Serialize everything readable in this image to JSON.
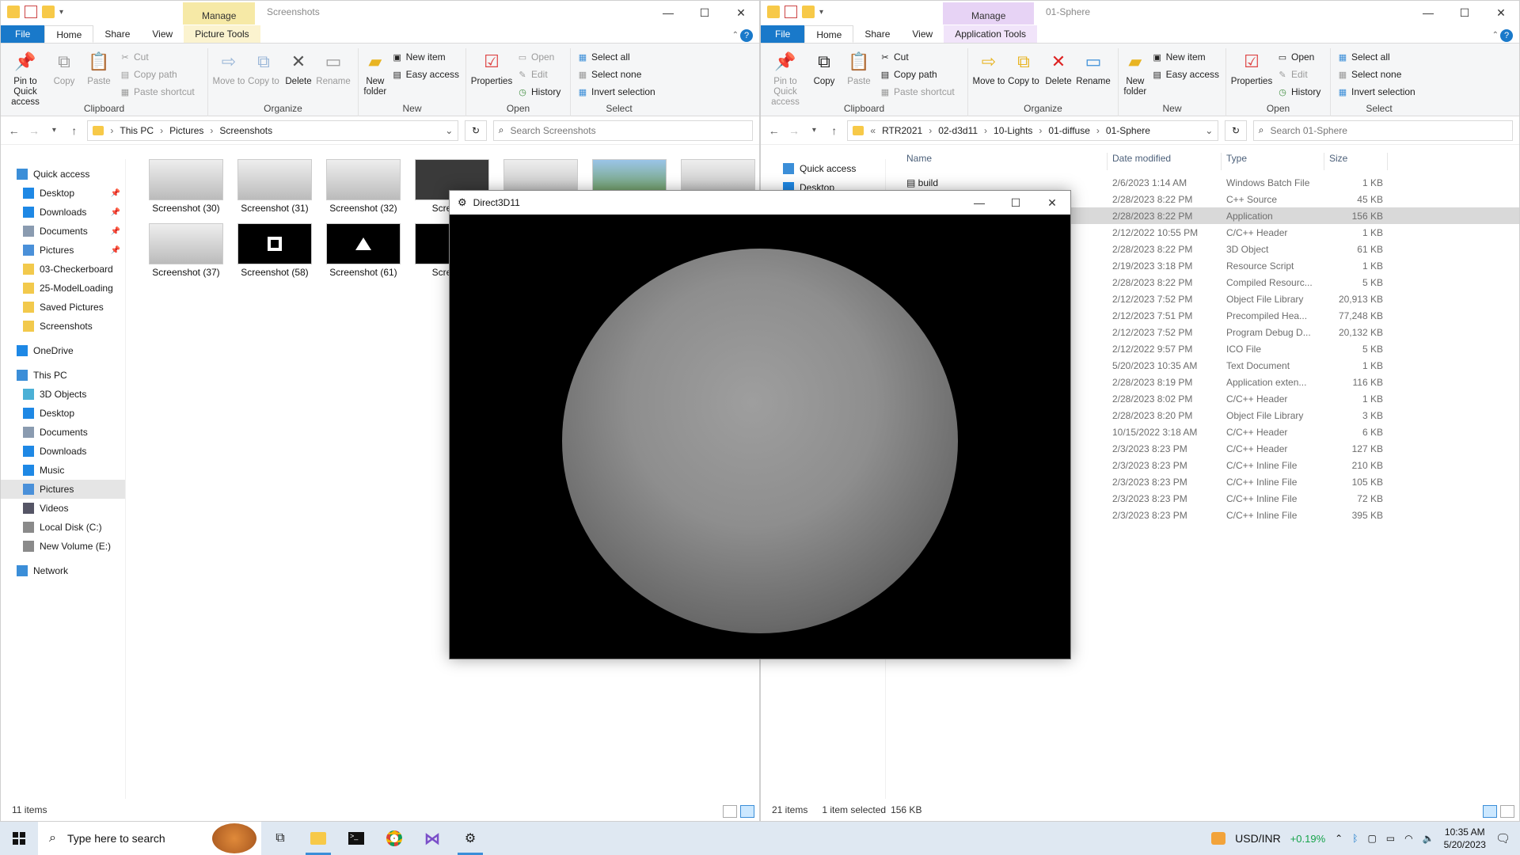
{
  "left": {
    "manage": "Manage",
    "title": "Screenshots",
    "tabs": [
      "File",
      "Home",
      "Share",
      "View",
      "Picture Tools"
    ],
    "ribbon": {
      "clipboard": {
        "label": "Clipboard",
        "pin": "Pin to Quick access",
        "copy": "Copy",
        "paste": "Paste",
        "cut": "Cut",
        "copy_path": "Copy path",
        "paste_shortcut": "Paste shortcut"
      },
      "organize": {
        "label": "Organize",
        "move": "Move to",
        "copy": "Copy to",
        "delete": "Delete",
        "rename": "Rename"
      },
      "new": {
        "label": "New",
        "folder": "New folder",
        "item": "New item",
        "easy": "Easy access"
      },
      "open": {
        "label": "Open",
        "properties": "Properties",
        "open": "Open",
        "edit": "Edit",
        "history": "History"
      },
      "select": {
        "label": "Select",
        "all": "Select all",
        "none": "Select none",
        "invert": "Invert selection"
      }
    },
    "crumbs": [
      "This PC",
      "Pictures",
      "Screenshots"
    ],
    "search_placeholder": "Search Screenshots",
    "nav": [
      {
        "label": "Quick access",
        "top": true,
        "icon": "star-icon"
      },
      {
        "label": "Desktop",
        "pin": true,
        "icon": "desktop-icon"
      },
      {
        "label": "Downloads",
        "pin": true,
        "icon": "download-icon"
      },
      {
        "label": "Documents",
        "pin": true,
        "icon": "documents-icon"
      },
      {
        "label": "Pictures",
        "pin": true,
        "icon": "pictures-icon"
      },
      {
        "label": "03-Checkerboard",
        "icon": "folder-icon"
      },
      {
        "label": "25-ModelLoading",
        "icon": "folder-icon"
      },
      {
        "label": "Saved Pictures",
        "icon": "folder-icon"
      },
      {
        "label": "Screenshots",
        "icon": "folder-icon"
      },
      {
        "label": "OneDrive",
        "top": true,
        "icon": "cloud-icon"
      },
      {
        "label": "This PC",
        "top": true,
        "icon": "pc-icon"
      },
      {
        "label": "3D Objects",
        "icon": "cube-icon"
      },
      {
        "label": "Desktop",
        "icon": "desktop-icon"
      },
      {
        "label": "Documents",
        "icon": "documents-icon"
      },
      {
        "label": "Downloads",
        "icon": "download-icon"
      },
      {
        "label": "Music",
        "icon": "music-icon"
      },
      {
        "label": "Pictures",
        "icon": "pictures-icon",
        "selected": true
      },
      {
        "label": "Videos",
        "icon": "video-icon"
      },
      {
        "label": "Local Disk (C:)",
        "icon": "disk-icon"
      },
      {
        "label": "New Volume (E:)",
        "icon": "disk-icon"
      },
      {
        "label": "Network",
        "top": true,
        "icon": "network-icon"
      }
    ],
    "thumbs": [
      {
        "label": "Screenshot (30)",
        "kind": "gray"
      },
      {
        "label": "Screenshot (31)",
        "kind": "gray"
      },
      {
        "label": "Screenshot (32)",
        "kind": "gray"
      },
      {
        "label": "Screensh",
        "kind": "dark"
      },
      {
        "label": "",
        "kind": "gray"
      },
      {
        "label": "",
        "kind": "tree"
      },
      {
        "label": "",
        "kind": "gray"
      },
      {
        "label": "Screenshot (37)",
        "kind": "gray"
      },
      {
        "label": "Screenshot (58)",
        "kind": "square"
      },
      {
        "label": "Screenshot (61)",
        "kind": "triangle"
      },
      {
        "label": "Screensh",
        "kind": "blk"
      }
    ],
    "status": {
      "items": "11 items"
    }
  },
  "right": {
    "manage": "Manage",
    "title": "01-Sphere",
    "tabs": [
      "File",
      "Home",
      "Share",
      "View",
      "Application Tools"
    ],
    "crumbs": [
      "RTR2021",
      "02-d3d11",
      "10-Lights",
      "01-diffuse",
      "01-Sphere"
    ],
    "crumb_prefix": "«",
    "search_placeholder": "Search 01-Sphere",
    "nav": [
      {
        "label": "Quick access",
        "icon": "star-icon"
      },
      {
        "label": "Desktop",
        "icon": "desktop-icon"
      }
    ],
    "headers": [
      "Name",
      "Date modified",
      "Type",
      "Size"
    ],
    "files": [
      {
        "name": "build",
        "date": "2/6/2023 1:14 AM",
        "type": "Windows Batch File",
        "size": "1 KB"
      },
      {
        "name": "",
        "date": "2/28/2023 8:22 PM",
        "type": "C++ Source",
        "size": "45 KB"
      },
      {
        "name": "",
        "date": "2/28/2023 8:22 PM",
        "type": "Application",
        "size": "156 KB",
        "selected": true
      },
      {
        "name": "",
        "date": "2/12/2022 10:55 PM",
        "type": "C/C++ Header",
        "size": "1 KB"
      },
      {
        "name": "",
        "date": "2/28/2023 8:22 PM",
        "type": "3D Object",
        "size": "61 KB"
      },
      {
        "name": "",
        "date": "2/19/2023 3:18 PM",
        "type": "Resource Script",
        "size": "1 KB"
      },
      {
        "name": "",
        "date": "2/28/2023 8:22 PM",
        "type": "Compiled Resourc...",
        "size": "5 KB"
      },
      {
        "name": "",
        "date": "2/12/2023 7:52 PM",
        "type": "Object File Library",
        "size": "20,913 KB"
      },
      {
        "name": "",
        "date": "2/12/2023 7:51 PM",
        "type": "Precompiled Hea...",
        "size": "77,248 KB"
      },
      {
        "name": "",
        "date": "2/12/2023 7:52 PM",
        "type": "Program Debug D...",
        "size": "20,132 KB"
      },
      {
        "name": "",
        "date": "2/12/2022 9:57 PM",
        "type": "ICO File",
        "size": "5 KB"
      },
      {
        "name": "",
        "date": "5/20/2023 10:35 AM",
        "type": "Text Document",
        "size": "1 KB"
      },
      {
        "name": "",
        "date": "2/28/2023 8:19 PM",
        "type": "Application exten...",
        "size": "116 KB"
      },
      {
        "name": "",
        "date": "2/28/2023 8:02 PM",
        "type": "C/C++ Header",
        "size": "1 KB"
      },
      {
        "name": "",
        "date": "2/28/2023 8:20 PM",
        "type": "Object File Library",
        "size": "3 KB"
      },
      {
        "name": "",
        "date": "10/15/2022 3:18 AM",
        "type": "C/C++ Header",
        "size": "6 KB"
      },
      {
        "name": "",
        "date": "2/3/2023 8:23 PM",
        "type": "C/C++ Header",
        "size": "127 KB"
      },
      {
        "name": "",
        "date": "2/3/2023 8:23 PM",
        "type": "C/C++ Inline File",
        "size": "210 KB"
      },
      {
        "name": "",
        "date": "2/3/2023 8:23 PM",
        "type": "C/C++ Inline File",
        "size": "105 KB"
      },
      {
        "name": "",
        "date": "2/3/2023 8:23 PM",
        "type": "C/C++ Inline File",
        "size": "72 KB"
      },
      {
        "name": "",
        "date": "2/3/2023 8:23 PM",
        "type": "C/C++ Inline File",
        "size": "395 KB"
      }
    ],
    "status": {
      "items": "21 items",
      "selected": "1 item selected",
      "size": "156 KB"
    }
  },
  "d3d": {
    "title": "Direct3D11"
  },
  "taskbar": {
    "search": "Type here to search",
    "ticker": "USD/INR",
    "change": "+0.19%",
    "time": "10:35 AM",
    "date": "5/20/2023"
  },
  "colors": {
    "accent": "#1979ca",
    "ticker_up": "#16a34a",
    "selection": "#cce8ff"
  }
}
